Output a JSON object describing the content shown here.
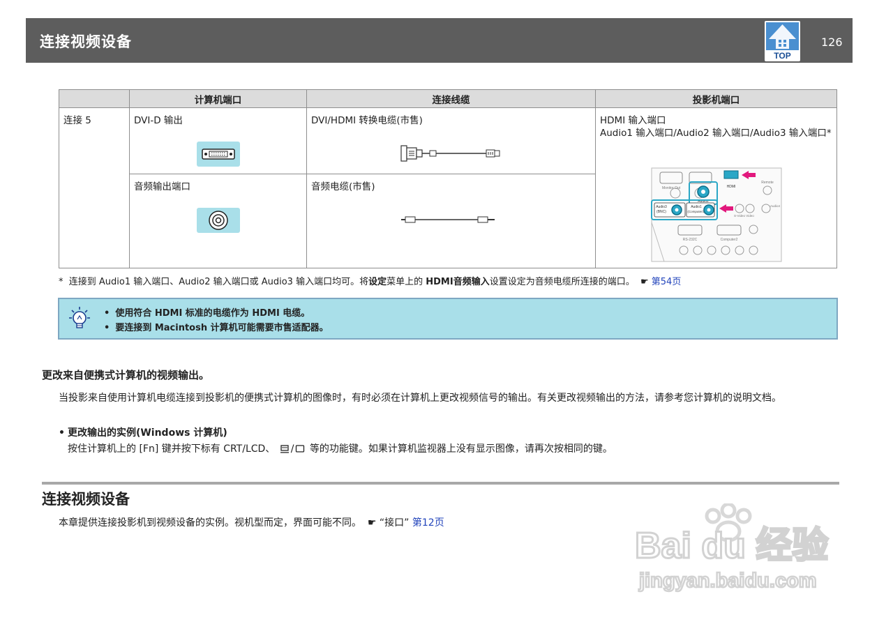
{
  "header": {
    "title": "连接视频设备",
    "top_label": "TOP",
    "page_number": "126"
  },
  "table": {
    "headers": [
      "",
      "计算机端口",
      "连接线缆",
      "投影机端口"
    ],
    "row_label": "连接 5",
    "pc_port_1": "DVI-D 输出",
    "cable_1": "DVI/HDMI 转换电缆(市售)",
    "projector_port_line1": "HDMI 输入端口",
    "projector_port_line2": "Audio1 输入端口/Audio2 输入端口/Audio3 输入端口*",
    "pc_port_2": "音频输出端口",
    "cable_2": "音频电缆(市售)",
    "panel_labels": {
      "monitor_out": "Monitor Out",
      "hdmi": "HDMI",
      "remote": "Remote",
      "audio1": "Audio1",
      "audio2": "Audio2",
      "audio3": "Audio3",
      "bnc": "(BNC)",
      "computer1": "(Computer1)",
      "video": "Video",
      "svideo": "S-Video",
      "audio4": "Audio4",
      "rs232c": "RS-232C",
      "computer2": "Computer2"
    }
  },
  "footnote": {
    "star": "*",
    "text1": "连接到 Audio1 输入端口、Audio2 输入端口或 Audio3 输入端口均可。将",
    "bold1": "设定",
    "text2": "菜单上的 ",
    "bold2": "HDMI音频输入",
    "text3": "设置设定为音频电缆所连接的端口。",
    "pointer": "☛",
    "link": "第54页"
  },
  "tips": [
    "使用符合 HDMI 标准的电缆作为 HDMI 电缆。",
    "要连接到 Macintosh 计算机可能需要市售适配器。"
  ],
  "section": {
    "heading": "更改来自便携式计算机的视频输出。",
    "paragraph": "当投影来自使用计算机电缆连接到投影机的便携式计算机的图像时，有时必须在计算机上更改视频信号的输出。有关更改视频输出的方法，请参考您计算机的说明文档。",
    "bullet_title": "更改输出的实例(Windows 计算机)",
    "bullet_body_1": "按住计算机上的 [Fn] 键并按下标有 CRT/LCD、",
    "bullet_body_sep": "/",
    "bullet_body_2": "等的功能键。如果计算机监视器上没有显示图像，请再次按相同的键。"
  },
  "chapter": {
    "heading": "连接视频设备",
    "intro": "本章提供连接投影机到视频设备的实例。视机型而定，界面可能不同。",
    "pointer": "☛",
    "ref": "“接口”",
    "link": "第12页"
  },
  "watermark": {
    "line1": "Bai du 经验",
    "line2": "jingyan.baidu.com"
  }
}
